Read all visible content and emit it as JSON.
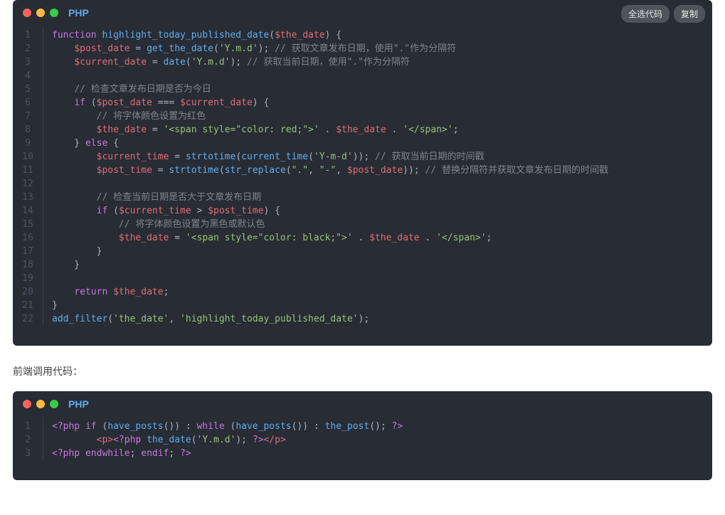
{
  "block1": {
    "lang": "PHP",
    "buttons": {
      "selectAll": "全选代码",
      "copy": "复制"
    },
    "lineCount": 22,
    "lines": [
      [
        [
          "kw",
          "function"
        ],
        [
          "plain",
          " "
        ],
        [
          "fn",
          "highlight_today_published_date"
        ],
        [
          "pn",
          "("
        ],
        [
          "var",
          "$the_date"
        ],
        [
          "pn",
          ") {"
        ]
      ],
      [
        [
          "plain",
          "    "
        ],
        [
          "var",
          "$post_date"
        ],
        [
          "plain",
          " = "
        ],
        [
          "fn",
          "get_the_date"
        ],
        [
          "pn",
          "("
        ],
        [
          "str",
          "'Y.m.d'"
        ],
        [
          "pn",
          "); "
        ],
        [
          "cmt",
          "// 获取文章发布日期，使用\".\"作为分隔符"
        ]
      ],
      [
        [
          "plain",
          "    "
        ],
        [
          "var",
          "$current_date"
        ],
        [
          "plain",
          " = "
        ],
        [
          "fn",
          "date"
        ],
        [
          "pn",
          "("
        ],
        [
          "str",
          "'Y.m.d'"
        ],
        [
          "pn",
          "); "
        ],
        [
          "cmt",
          "// 获取当前日期，使用\".\"作为分隔符"
        ]
      ],
      [
        [
          "plain",
          "    "
        ]
      ],
      [
        [
          "plain",
          "    "
        ],
        [
          "cmt",
          "// 检查文章发布日期是否为今日"
        ]
      ],
      [
        [
          "plain",
          "    "
        ],
        [
          "kw",
          "if"
        ],
        [
          "plain",
          " ("
        ],
        [
          "var",
          "$post_date"
        ],
        [
          "plain",
          " === "
        ],
        [
          "var",
          "$current_date"
        ],
        [
          "pn",
          ") {"
        ]
      ],
      [
        [
          "plain",
          "        "
        ],
        [
          "cmt",
          "// 将字体颜色设置为红色"
        ]
      ],
      [
        [
          "plain",
          "        "
        ],
        [
          "var",
          "$the_date"
        ],
        [
          "plain",
          " = "
        ],
        [
          "str",
          "'<span style=\"color: red;\">'"
        ],
        [
          "plain",
          " . "
        ],
        [
          "var",
          "$the_date"
        ],
        [
          "plain",
          " . "
        ],
        [
          "str",
          "'</span>'"
        ],
        [
          "pn",
          ";"
        ]
      ],
      [
        [
          "plain",
          "    } "
        ],
        [
          "kw",
          "else"
        ],
        [
          "pn",
          " {"
        ]
      ],
      [
        [
          "plain",
          "        "
        ],
        [
          "var",
          "$current_time"
        ],
        [
          "plain",
          " = "
        ],
        [
          "fn",
          "strtotime"
        ],
        [
          "pn",
          "("
        ],
        [
          "fn",
          "current_time"
        ],
        [
          "pn",
          "("
        ],
        [
          "str",
          "'Y-m-d'"
        ],
        [
          "pn",
          ")); "
        ],
        [
          "cmt",
          "// 获取当前日期的时间戳"
        ]
      ],
      [
        [
          "plain",
          "        "
        ],
        [
          "var",
          "$post_time"
        ],
        [
          "plain",
          " = "
        ],
        [
          "fn",
          "strtotime"
        ],
        [
          "pn",
          "("
        ],
        [
          "fn",
          "str_replace"
        ],
        [
          "pn",
          "("
        ],
        [
          "str",
          "\".\""
        ],
        [
          "pn",
          ", "
        ],
        [
          "str",
          "\"-\""
        ],
        [
          "pn",
          ", "
        ],
        [
          "var",
          "$post_date"
        ],
        [
          "pn",
          ")); "
        ],
        [
          "cmt",
          "// 替换分隔符并获取文章发布日期的时间戳"
        ]
      ],
      [
        [
          "plain",
          "        "
        ]
      ],
      [
        [
          "plain",
          "        "
        ],
        [
          "cmt",
          "// 检查当前日期是否大于文章发布日期"
        ]
      ],
      [
        [
          "plain",
          "        "
        ],
        [
          "kw",
          "if"
        ],
        [
          "plain",
          " ("
        ],
        [
          "var",
          "$current_time"
        ],
        [
          "plain",
          " > "
        ],
        [
          "var",
          "$post_time"
        ],
        [
          "pn",
          ") {"
        ]
      ],
      [
        [
          "plain",
          "            "
        ],
        [
          "cmt",
          "// 将字体颜色设置为黑色或默认色"
        ]
      ],
      [
        [
          "plain",
          "            "
        ],
        [
          "var",
          "$the_date"
        ],
        [
          "plain",
          " = "
        ],
        [
          "str",
          "'<span style=\"color: black;\">'"
        ],
        [
          "plain",
          " . "
        ],
        [
          "var",
          "$the_date"
        ],
        [
          "plain",
          " . "
        ],
        [
          "str",
          "'</span>'"
        ],
        [
          "pn",
          ";"
        ]
      ],
      [
        [
          "plain",
          "        }"
        ]
      ],
      [
        [
          "plain",
          "    }"
        ]
      ],
      [
        [
          "plain",
          "    "
        ]
      ],
      [
        [
          "plain",
          "    "
        ],
        [
          "kw",
          "return"
        ],
        [
          "plain",
          " "
        ],
        [
          "var",
          "$the_date"
        ],
        [
          "pn",
          ";"
        ]
      ],
      [
        [
          "pn",
          "}"
        ]
      ],
      [
        [
          "fn",
          "add_filter"
        ],
        [
          "pn",
          "("
        ],
        [
          "str",
          "'the_date'"
        ],
        [
          "pn",
          ", "
        ],
        [
          "str",
          "'highlight_today_published_date'"
        ],
        [
          "pn",
          ");"
        ]
      ]
    ]
  },
  "intertext": "前端调用代码：",
  "block2": {
    "lang": "PHP",
    "lineCount": 3,
    "lines": [
      [
        [
          "php-tag",
          "<?php"
        ],
        [
          "plain",
          " "
        ],
        [
          "kw",
          "if"
        ],
        [
          "plain",
          " ("
        ],
        [
          "fn",
          "have_posts"
        ],
        [
          "pn",
          "()) : "
        ],
        [
          "kw",
          "while"
        ],
        [
          "plain",
          " ("
        ],
        [
          "fn",
          "have_posts"
        ],
        [
          "pn",
          "()) : "
        ],
        [
          "fn",
          "the_post"
        ],
        [
          "pn",
          "(); "
        ],
        [
          "php-tag",
          "?>"
        ]
      ],
      [
        [
          "plain",
          "        "
        ],
        [
          "tag",
          "<p>"
        ],
        [
          "php-tag",
          "<?php"
        ],
        [
          "plain",
          " "
        ],
        [
          "fn",
          "the_date"
        ],
        [
          "pn",
          "("
        ],
        [
          "str",
          "'Y.m.d'"
        ],
        [
          "pn",
          "); "
        ],
        [
          "php-tag",
          "?>"
        ],
        [
          "tag",
          "</p>"
        ]
      ],
      [
        [
          "php-tag",
          "<?php"
        ],
        [
          "plain",
          " "
        ],
        [
          "kw",
          "endwhile"
        ],
        [
          "pn",
          "; "
        ],
        [
          "kw",
          "endif"
        ],
        [
          "pn",
          "; "
        ],
        [
          "php-tag",
          "?>"
        ]
      ]
    ]
  }
}
